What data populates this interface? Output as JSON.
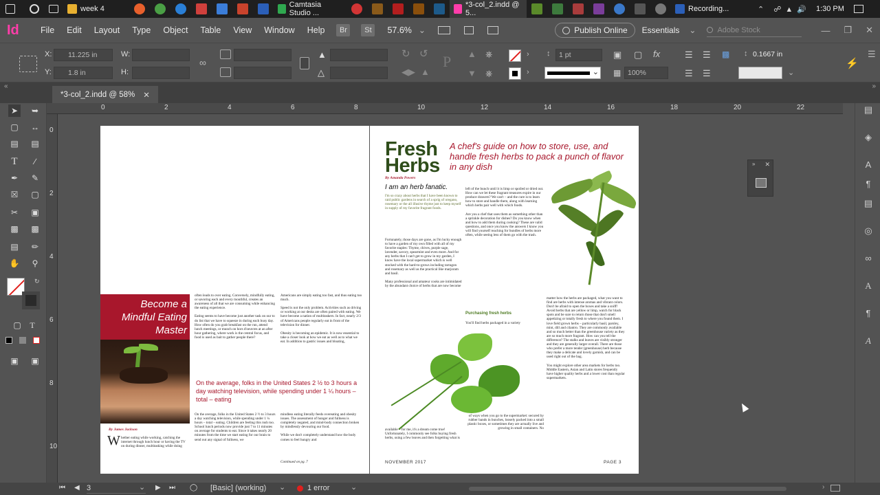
{
  "taskbar": {
    "tasks": [
      {
        "label": "week 4",
        "color": "#e8b030"
      },
      {
        "label": "Camtasia Studio ...",
        "color": "#2fa84f"
      },
      {
        "label": "*3-col_2.indd @ 5...",
        "color": "#ff3daa"
      },
      {
        "label": "Recording...",
        "color": "#2b5fb8"
      }
    ],
    "clock": "1:30 PM"
  },
  "menubar": {
    "logo": "Id",
    "items": [
      "File",
      "Edit",
      "Layout",
      "Type",
      "Object",
      "Table",
      "View",
      "Window",
      "Help"
    ],
    "br_label": "Br",
    "st_label": "St",
    "zoom": "57.6%",
    "publish": "Publish Online",
    "workspace": "Essentials",
    "search_placeholder": "Adobe Stock"
  },
  "control": {
    "x_label": "X:",
    "x_value": "11.225 in",
    "y_label": "Y:",
    "y_value": "1.8 in",
    "w_label": "W:",
    "h_label": "H:",
    "stroke_weight": "1 pt",
    "opacity": "100%",
    "gap_value": "0.1667 in"
  },
  "document": {
    "tab_label": "*3-col_2.indd @ 58%",
    "ruler_top": [
      "0",
      "2",
      "4",
      "6",
      "8",
      "10",
      "12",
      "14",
      "16",
      "18",
      "20",
      "22"
    ],
    "ruler_left": [
      "0",
      "2",
      "4",
      "6",
      "8",
      "10"
    ]
  },
  "left_page": {
    "box_title": "Become a Mindful Eating Master",
    "byline": "By James Jackson",
    "drop_cap": "W",
    "col1_intro": "hether eating while working, catching the internet through lunch hour or having the TV on during dinner, multitasking while doing",
    "col2_top": "often leads to over eating. Conversely, mindfully eating, or savoring each and every mouthful, creates an awareness of all that we are consuming while enhancing the eating experience.\n\nEating seems to have become just another task on our to do list that we have to squeeze in during each busy day. How often do you grab breakfast on the run, attend lunch meetings, or munch on hors d'oeuvres at an after hour gathering, where work is the central focus, and food is used as bait to gather people there?",
    "col3_top": "Americans are simply eating too fast, and thus eating too much.\n\nSpeed is not the only problem. Activities such as driving or working at our desks are often paired with eating. We have become a nation of multitaskers. In fact, nearly 2/3 of Americans people regularly eat in front of the television for dinner.\n\nObesity is becoming an epidemic. It is now essential to take a closer look at how we eat as well as to what we eat. In addition to gastric issues and bloating,",
    "pull_quote": "On the average, folks in the United States 2 ½ to 3 hours a day watching television, while spending under 1 ¼ hours – total – eating",
    "col2_bottom": "On the average, folks in the United States 2 ½ to 3 hours a day watching television, while spending under 1 ¼ hours – total – eating. Children are feeling this rush too. School lunch periods now provide just 7 to 11 minutes on average for students to eat. Since it takes nearly 20 minutes from the time we start eating for our brain to send out any signal of fullness, we",
    "col3_bottom": "mindless eating literally feeds overeating and obesity issues. The assessment of hunger and fullness is completely negated, and mind-body connection broken by mindlessly devouring our food.\n\nWhile we don't completely understand how the body comes to feel hungry and",
    "continued": "Continued on pg. 7"
  },
  "right_page": {
    "title": "Fresh Herbs",
    "subtitle": "A chef's guide on how to store, use, and handle fresh herbs to pack a punch of flavor in any dish",
    "byline": "By Amanda Powers",
    "heading": "I am an herb fanatic.",
    "intro": "I'm so crazy about herbs that I have been known to raid public gardens in search of a sprig of oregano, rosemary or the all illusive thyme just to keep myself in supply of my favorite fragrant foods.",
    "col1": "Fortunately, those days are gone, as I'm lucky enough to have a garden of my own filled with all of my favorite staples: Thyme, chives, purple sage, lavender, savory, spearmint and even more. And for any herbs that I can't get to grow in my garden, I know have the local supermarket which is well stocked with the hard-to-grows including tarragon and rosemary as well as the practical like marjoram and basil.\n\nMany professional and amateur cooks are intimidated by the abundant choice of herbs that are now become",
    "col2": "left of the bunch until it is limp or spoiled or dried out. How can we let these fragrant treasures expire in our produce drawers? We can't – and the cure is to learn how to store and handle them, along with learning which herbs pair well with which foods.\n\nAre you a chef that uses them as something other than a sprinkle decoration for dishes? Do you know when and how to add them during cooking? These are valid questions, and once you know the answers I know you will find yourself reaching for bundles of herbs more often, while seeing less of them go with the trash.",
    "subheading": "Purchasing fresh herbs",
    "col2b": "You'll find herbs packaged in a variety",
    "col3": "matter how the herbs are packaged, what you want to find are herbs with intense aromas and vibrant colors. Don't be afraid to open the boxes and take a sniff! Avoid herbs that are yellow or limp, watch for black spots and be sure to return those that don't smell appetizing or totally fresh to where you found them. I love field grown herbs – particularly basil, parsley, mint, dill and cilantro. They are commonly available and so much better than the greenhouse variety as they are so much more fragrant. How can you tell the difference? The stalks and leaves are visibly stronger and they are generally larger overall. There are those who prefer a more tender (greenhouse) herb because they make a delicate and lovely garnish, and can be used right out of the bag.\n\nYou might explore other area markets for herbs too. Middle Eastern, Asian and Latin stores frequently have higher quality herbs and a lower cost than regular supermarkets.",
    "bottom1": "available – for me, it's a dream come true! Unfortunately, I commonly see folks buying fresh herbs, using a few leaves and then forgetting what is",
    "bottom2": "of ways when you go to the supermarket: secured by rubber bands in bunches, loosely packed into a small plastic boxes, or sometimes they are actually live and growing in small containers. No",
    "folio_left": "NOVEMBER 2017",
    "folio_right": "PAGE 3"
  },
  "status": {
    "page_number": "3",
    "preflight_profile": "[Basic] (working)",
    "errors": "1 error"
  }
}
